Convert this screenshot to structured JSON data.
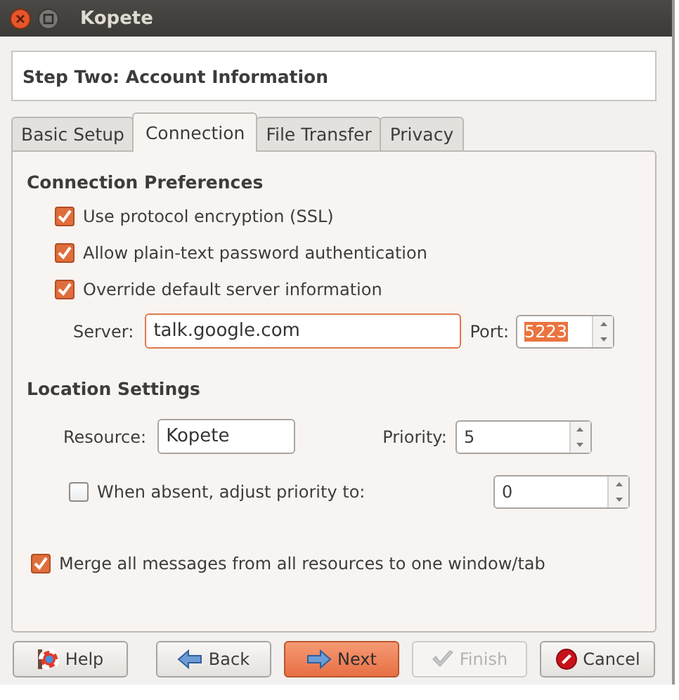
{
  "window": {
    "title": "Kopete"
  },
  "header": "Step Two: Account Information",
  "tabs": [
    {
      "label": "Basic Setup",
      "selected": false
    },
    {
      "label": "Connection",
      "selected": true
    },
    {
      "label": "File Transfer",
      "selected": false
    },
    {
      "label": "Privacy",
      "selected": false
    }
  ],
  "connection_preferences": {
    "heading": "Connection Preferences",
    "checkboxes": [
      {
        "label": "Use protocol encryption (SSL)",
        "checked": true
      },
      {
        "label": "Allow plain-text password authentication",
        "checked": true
      },
      {
        "label": "Override default server information",
        "checked": true
      }
    ],
    "server": {
      "label": "Server:",
      "value": "talk.google.com",
      "focused": true
    },
    "port": {
      "label": "Port:",
      "value": "5223",
      "highlighted": true
    }
  },
  "location_settings": {
    "heading": "Location Settings",
    "resource": {
      "label": "Resource:",
      "value": "Kopete"
    },
    "priority": {
      "label": "Priority:",
      "value": "5"
    },
    "absent": {
      "label": "When absent, adjust priority to:",
      "checked": false,
      "value": "0"
    }
  },
  "merge": {
    "label": "Merge all messages from all resources to one window/tab",
    "checked": true
  },
  "buttons": [
    {
      "label": "Help",
      "kind": "help",
      "default": false,
      "disabled": false
    },
    {
      "label": "Back",
      "kind": "back",
      "default": false,
      "disabled": false
    },
    {
      "label": "Next",
      "kind": "next",
      "default": true,
      "disabled": false
    },
    {
      "label": "Finish",
      "kind": "finish",
      "default": false,
      "disabled": true
    },
    {
      "label": "Cancel",
      "kind": "cancel",
      "default": false,
      "disabled": false
    }
  ]
}
